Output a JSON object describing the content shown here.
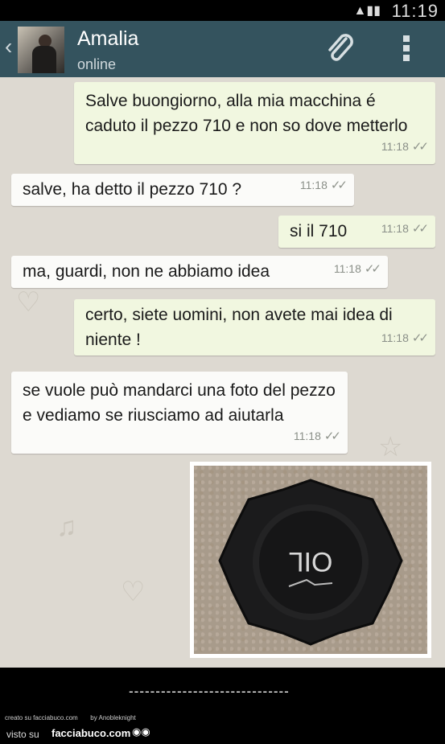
{
  "status_bar": {
    "time": "11:19"
  },
  "header": {
    "back_icon": "chevron-left-icon",
    "contact_name": "Amalia",
    "contact_status": "online",
    "attach_icon": "paperclip-icon",
    "menu_icon": "overflow-menu-icon"
  },
  "messages": [
    {
      "direction": "out",
      "text": "Salve buongiorno, alla mia macchina é caduto il pezzo 710 e non so dove metterlo",
      "time": "11:18"
    },
    {
      "direction": "in",
      "text": "salve, ha detto il pezzo 710 ?",
      "time": "11:18"
    },
    {
      "direction": "out",
      "text": "si il 710",
      "time": "11:18"
    },
    {
      "direction": "in",
      "text": "ma, guardi, non ne abbiamo idea",
      "time": "11:18"
    },
    {
      "direction": "out",
      "text": "certo, siete uomini, non avete mai idea di niente !",
      "time": "11:18"
    },
    {
      "direction": "in",
      "text": "se vuole può mandarci una foto del pezzo e vediamo se riusciamo ad aiutarla",
      "time": "11:18"
    }
  ],
  "photo": {
    "cap_text": "OIL"
  },
  "footer": {
    "dashes": "------------------------------",
    "credit_left": "creato su facciabuco.com",
    "credit_right": "by Anobleknight",
    "visto_su": "visto su",
    "site": "facciabuco.com"
  }
}
